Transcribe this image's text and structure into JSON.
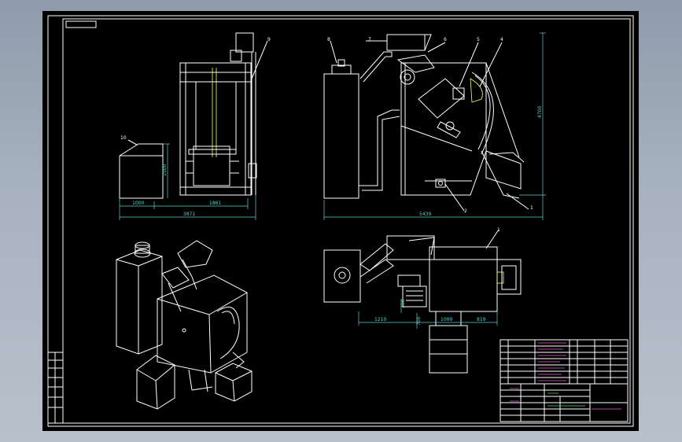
{
  "drawing": {
    "background": "#000000",
    "line_color": "#ffffff",
    "dimension_color": "#5fd0d0",
    "accent_color": "#ffff66"
  },
  "dimensions": {
    "left_width_1": "1000",
    "left_width_2": "1861",
    "left_total": "3871",
    "left_height": "1500",
    "front_total": "5439",
    "front_height": "4700",
    "plan_a": "1210",
    "plan_b": "1000",
    "plan_c": "819",
    "plan_d": "380",
    "plan_e": "700"
  },
  "part_numbers": {
    "p1": "1",
    "p2": "2",
    "p4": "4",
    "p5": "5",
    "p6": "6",
    "p7": "7",
    "p8": "8",
    "p9": "9",
    "p10": "10",
    "p1_plan": "1"
  }
}
